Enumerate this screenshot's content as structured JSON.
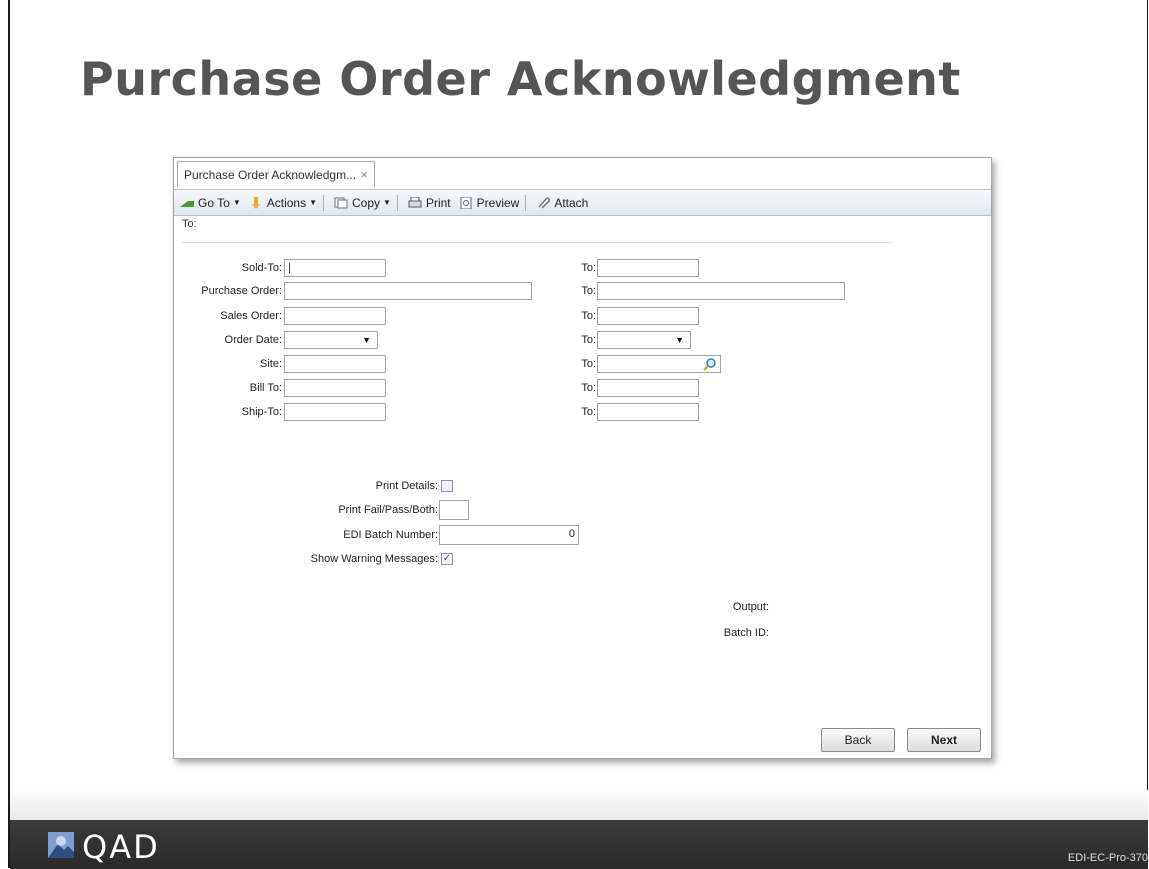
{
  "slide": {
    "title": "Purchase Order Acknowledgment"
  },
  "window": {
    "tab_label": "Purchase Order Acknowledgm...",
    "tab_close": "×",
    "toolbar": {
      "goto": "Go To",
      "actions": "Actions",
      "copy": "Copy",
      "print": "Print",
      "preview": "Preview",
      "attach": "Attach"
    },
    "header_to": "To:"
  },
  "form": {
    "sold_to": {
      "label": "Sold-To:",
      "value": "|",
      "to_label": "To:",
      "to_value": ""
    },
    "purchase_order": {
      "label": "Purchase Order:",
      "value": "",
      "to_label": "To:",
      "to_value": ""
    },
    "sales_order": {
      "label": "Sales Order:",
      "value": "",
      "to_label": "To:",
      "to_value": ""
    },
    "order_date": {
      "label": "Order Date:",
      "value": "",
      "to_label": "To:",
      "to_value": ""
    },
    "site": {
      "label": "Site:",
      "value": "",
      "to_label": "To:",
      "to_value": ""
    },
    "bill_to": {
      "label": "Bill To:",
      "value": "",
      "to_label": "To:",
      "to_value": ""
    },
    "ship_to": {
      "label": "Ship-To:",
      "value": "",
      "to_label": "To:",
      "to_value": ""
    },
    "print_details": {
      "label": "Print Details:",
      "checked": false
    },
    "print_fail_pass": {
      "label": "Print Fail/Pass/Both:",
      "value": ""
    },
    "edi_batch_number": {
      "label": "EDI Batch Number:",
      "value": "0"
    },
    "show_warnings": {
      "label": "Show Warning Messages:",
      "checked": true
    },
    "output_label": "Output:",
    "batch_id_label": "Batch ID:"
  },
  "buttons": {
    "back": "Back",
    "next": "Next"
  },
  "footer": {
    "brand": "QAD",
    "slide_code": "EDI-EC-Pro-370"
  },
  "colors": {
    "title": "#555555",
    "toolbar_bg": "#dfe6ef",
    "footer_bg": "#2f2f2f",
    "logo": "#6d8fc4"
  }
}
